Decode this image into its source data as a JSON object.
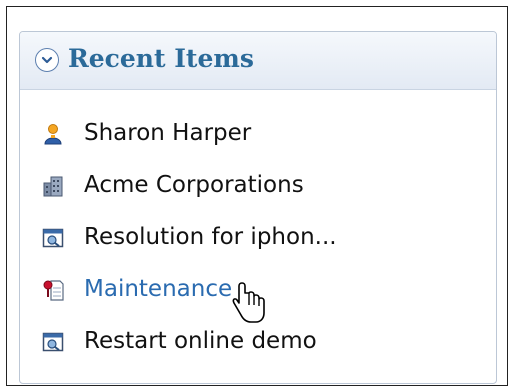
{
  "panel": {
    "title": "Recent Items",
    "toggle_icon": "chevron-down-icon"
  },
  "items": [
    {
      "label": "Sharon Harper",
      "icon": "contact-person-icon"
    },
    {
      "label": "Acme Corporations",
      "icon": "account-building-icon"
    },
    {
      "label": "Resolution for iphon...",
      "icon": "solution-document-icon"
    },
    {
      "label": "Maintenance",
      "icon": "case-pin-icon",
      "hovered": true
    },
    {
      "label": "Restart online demo",
      "icon": "solution-document-icon"
    }
  ],
  "colors": {
    "title": "#2b6a99",
    "link_hover": "#2a6bb0",
    "header_bg": "#e3eaf4"
  }
}
